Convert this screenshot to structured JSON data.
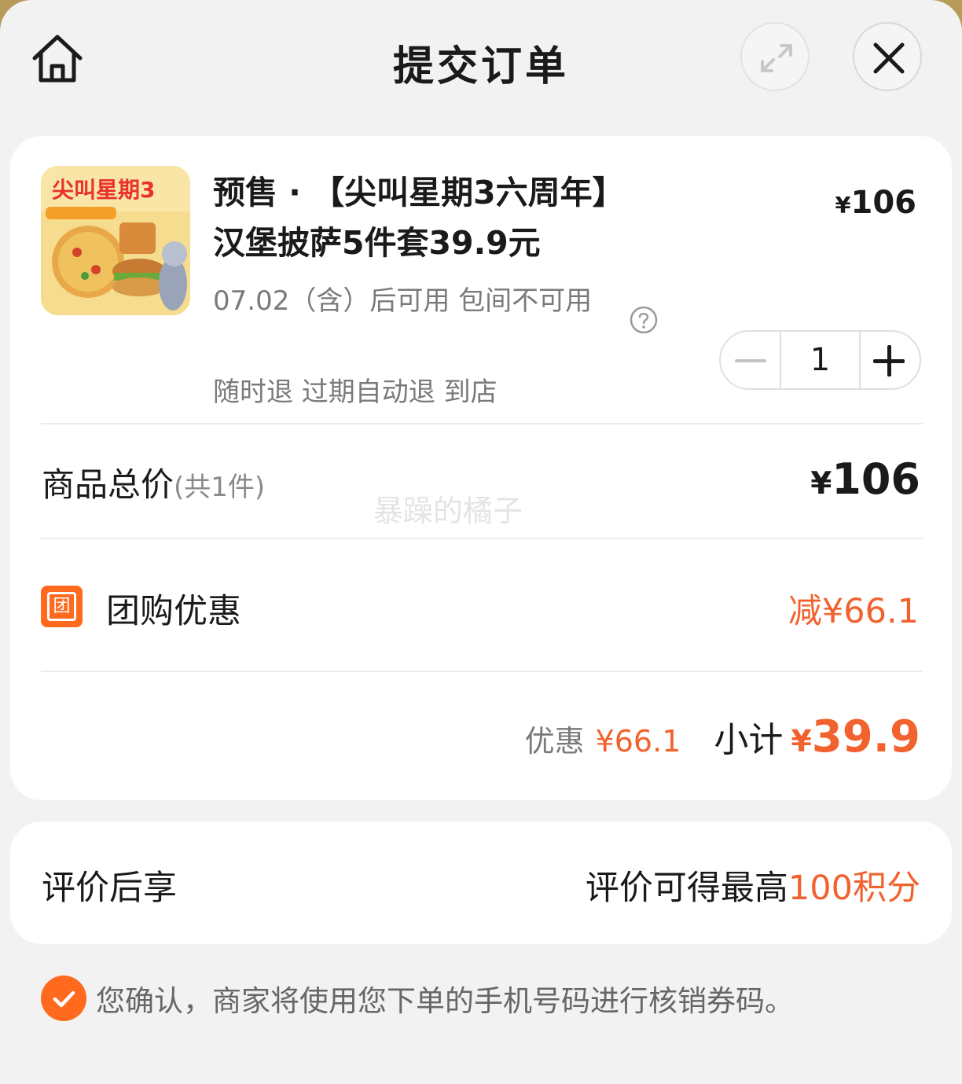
{
  "header": {
    "title": "提交订单",
    "home_icon": "home-icon",
    "expand_icon": "expand-icon",
    "close_icon": "close-icon"
  },
  "product": {
    "name": "预售 · 【尖叫星期3六周年】汉堡披萨5件套39.9元",
    "thumbnail_icon": "product-image",
    "thumbnail_text": "尖叫星期3",
    "unit_price_symbol": "¥",
    "unit_price": "106",
    "usage_note": "07.02（含）后可用 包间不可用",
    "refund_tags": "随时退 过期自动退 到店",
    "quantity": "1"
  },
  "summary": {
    "total_label": "商品总价",
    "total_count": "(共1件)",
    "total_symbol": "¥",
    "total_price": "106",
    "watermark": "暴躁的橘子",
    "groupbuy_badge": "团",
    "groupbuy_label": "团购优惠",
    "groupbuy_value": "减¥66.1",
    "discount_label": "优惠",
    "discount_value": "¥66.1",
    "subtotal_label": "小计",
    "subtotal_symbol": "¥",
    "subtotal_value": "39.9"
  },
  "review": {
    "label": "评价后享",
    "reward_prefix": "评价可得最高",
    "reward_points": "100积分"
  },
  "confirm": {
    "text": "您确认，商家将使用您下单的手机号码进行核销券码。"
  },
  "colors": {
    "accent": "#f2622e",
    "badge": "#ff6a1e",
    "page_bg": "#f2f2f2"
  }
}
